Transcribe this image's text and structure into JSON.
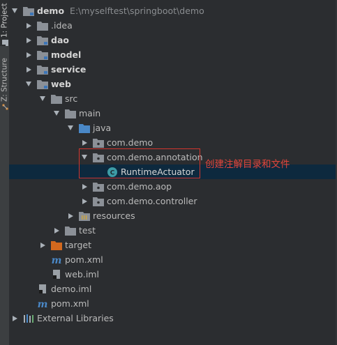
{
  "side_tabs": {
    "project": "1: Project",
    "structure": "Z: Structure"
  },
  "tree": {
    "root": {
      "name": "demo",
      "path": "E:\\myselftest\\springboot\\demo"
    },
    "idea": ".idea",
    "dao": "dao",
    "model": "model",
    "service": "service",
    "web": "web",
    "src": "src",
    "main": "main",
    "java": "java",
    "pkg_demo": "com.demo",
    "pkg_annotation": "com.demo.annotation",
    "runtime_actuator": "RuntimeActuator",
    "pkg_aop": "com.demo.aop",
    "pkg_controller": "com.demo.controller",
    "resources": "resources",
    "test": "test",
    "target": "target",
    "web_pom": "pom.xml",
    "web_iml": "web.iml",
    "demo_iml": "demo.iml",
    "root_pom": "pom.xml",
    "external_libraries": "External Libraries"
  },
  "annotation": "创建注解目录和文件",
  "colors": {
    "background": "#2b2d30",
    "selection": "#0d293e",
    "folder": "#8b9097",
    "source_folder": "#4a88c7",
    "excluded_folder": "#d2691e",
    "annotation_red": "#e0453d",
    "maven_blue": "#4a88c7",
    "class_teal": "#3d9ca6"
  }
}
